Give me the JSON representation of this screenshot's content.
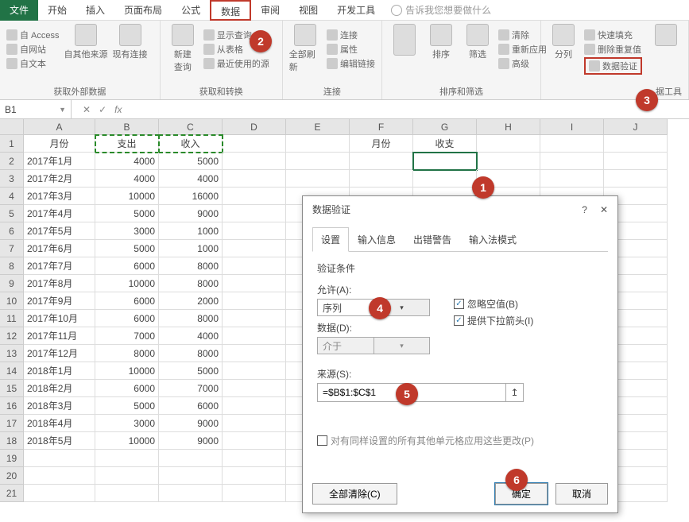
{
  "menu": {
    "file": "文件",
    "tabs": [
      "开始",
      "插入",
      "页面布局",
      "公式",
      "数据",
      "审阅",
      "视图",
      "开发工具"
    ],
    "active_index": 4,
    "tell_me": "告诉我您想要做什么"
  },
  "ribbon": {
    "group1": {
      "label": "获取外部数据",
      "access": "自 Access",
      "web": "自网站",
      "text": "自文本",
      "other": "自其他来源",
      "existing": "现有连接"
    },
    "group2": {
      "label": "获取和转换",
      "newq": "新建\n查询",
      "show": "显示查询",
      "table": "从表格",
      "recent": "最近使用的源"
    },
    "group3": {
      "label": "连接",
      "refresh": "全部刷新",
      "conn": "连接",
      "prop": "属性",
      "edit": "编辑链接"
    },
    "group4": {
      "label": "排序和筛选",
      "sort": "排序",
      "filter": "筛选",
      "clear": "清除",
      "reapply": "重新应用",
      "adv": "高级"
    },
    "group5": {
      "label": "据工具",
      "split": "分列",
      "flash": "快速填充",
      "dup": "删除重复值",
      "dv": "数据验证"
    }
  },
  "namebox": "B1",
  "columns": [
    "A",
    "B",
    "C",
    "D",
    "E",
    "F",
    "G",
    "H",
    "I",
    "J"
  ],
  "headers_main": {
    "A": "月份",
    "B": "支出",
    "C": "收入"
  },
  "headers_right": {
    "F": "月份",
    "G": "收支"
  },
  "rows": [
    {
      "m": "2017年1月",
      "o": "4000",
      "i": "5000"
    },
    {
      "m": "2017年2月",
      "o": "4000",
      "i": "4000"
    },
    {
      "m": "2017年3月",
      "o": "10000",
      "i": "16000"
    },
    {
      "m": "2017年4月",
      "o": "5000",
      "i": "9000"
    },
    {
      "m": "2017年5月",
      "o": "3000",
      "i": "1000"
    },
    {
      "m": "2017年6月",
      "o": "5000",
      "i": "1000"
    },
    {
      "m": "2017年7月",
      "o": "6000",
      "i": "8000"
    },
    {
      "m": "2017年8月",
      "o": "10000",
      "i": "8000"
    },
    {
      "m": "2017年9月",
      "o": "6000",
      "i": "2000"
    },
    {
      "m": "2017年10月",
      "o": "6000",
      "i": "8000"
    },
    {
      "m": "2017年11月",
      "o": "7000",
      "i": "4000"
    },
    {
      "m": "2017年12月",
      "o": "8000",
      "i": "8000"
    },
    {
      "m": "2018年1月",
      "o": "10000",
      "i": "5000"
    },
    {
      "m": "2018年2月",
      "o": "6000",
      "i": "7000"
    },
    {
      "m": "2018年3月",
      "o": "5000",
      "i": "6000"
    },
    {
      "m": "2018年4月",
      "o": "3000",
      "i": "9000"
    },
    {
      "m": "2018年5月",
      "o": "10000",
      "i": "9000"
    }
  ],
  "dialog": {
    "title": "数据验证",
    "help": "?",
    "tabs": [
      "设置",
      "输入信息",
      "出错警告",
      "输入法模式"
    ],
    "section": "验证条件",
    "allow_label": "允许(A):",
    "allow_value": "序列",
    "data_label": "数据(D):",
    "data_value": "介于",
    "source_label": "来源(S):",
    "source_value": "=$B$1:$C$1",
    "chk_blank": "忽略空值(B)",
    "chk_dropdown": "提供下拉箭头(I)",
    "chk_apply": "对有同样设置的所有其他单元格应用这些更改(P)",
    "clear": "全部清除(C)",
    "ok": "确定",
    "cancel": "取消"
  },
  "callouts": {
    "1": "1",
    "2": "2",
    "3": "3",
    "4": "4",
    "5": "5",
    "6": "6"
  }
}
